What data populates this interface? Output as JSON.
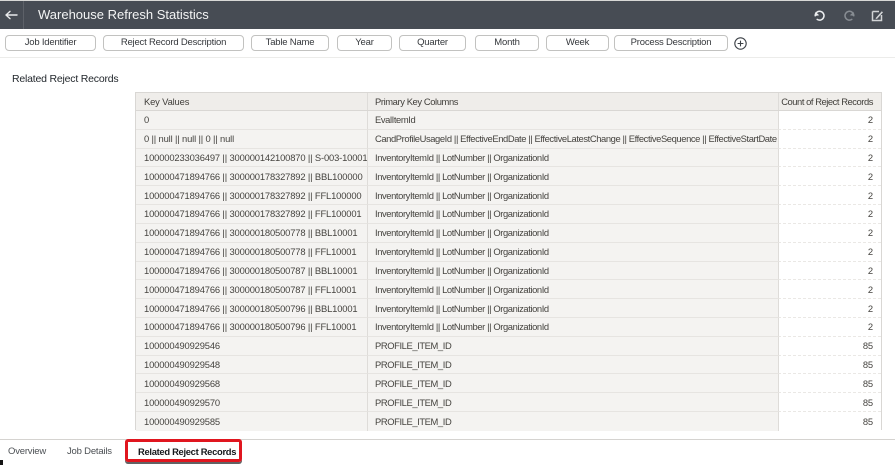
{
  "header": {
    "title": "Warehouse Refresh Statistics",
    "accent_color": "#474c54",
    "icons": [
      "back-arrow",
      "undo",
      "redo",
      "edit"
    ]
  },
  "filter_bar": {
    "chips": [
      {
        "label": "Job Identifier"
      },
      {
        "label": "Reject Record Description"
      },
      {
        "label": "Table Name"
      },
      {
        "label": "Year"
      },
      {
        "label": "Quarter"
      },
      {
        "label": "Month"
      },
      {
        "label": "Week"
      },
      {
        "label": "Process Description"
      }
    ],
    "add_filter_icon": "plus-circle"
  },
  "section": {
    "title": "Related Reject Records"
  },
  "table": {
    "columns": [
      "Key Values",
      "Primary Key Columns",
      "Count of Reject Records"
    ],
    "rows": [
      {
        "key_values": "0",
        "primary_key_columns": "EvalItemId",
        "count": "2"
      },
      {
        "key_values": "0 || null || null || 0 || null",
        "primary_key_columns": "CandProfileUsageId || EffectiveEndDate || EffectiveLatestChange || EffectiveSequence || EffectiveStartDate",
        "count": "2"
      },
      {
        "key_values": "100000233036497 || 300000142100870 || S-003-10001",
        "primary_key_columns": "InventoryItemId || LotNumber || OrganizationId",
        "count": "2"
      },
      {
        "key_values": "100000471894766 || 300000178327892 || BBL100000",
        "primary_key_columns": "InventoryItemId || LotNumber || OrganizationId",
        "count": "2"
      },
      {
        "key_values": "100000471894766 || 300000178327892 || FFL100000",
        "primary_key_columns": "InventoryItemId || LotNumber || OrganizationId",
        "count": "2"
      },
      {
        "key_values": "100000471894766 || 300000178327892 || FFL100001",
        "primary_key_columns": "InventoryItemId || LotNumber || OrganizationId",
        "count": "2"
      },
      {
        "key_values": "100000471894766 || 300000180500778 || BBL10001",
        "primary_key_columns": "InventoryItemId || LotNumber || OrganizationId",
        "count": "2"
      },
      {
        "key_values": "100000471894766 || 300000180500778 || FFL10001",
        "primary_key_columns": "InventoryItemId || LotNumber || OrganizationId",
        "count": "2"
      },
      {
        "key_values": "100000471894766 || 300000180500787 || BBL10001",
        "primary_key_columns": "InventoryItemId || LotNumber || OrganizationId",
        "count": "2"
      },
      {
        "key_values": "100000471894766 || 300000180500787 || FFL10001",
        "primary_key_columns": "InventoryItemId || LotNumber || OrganizationId",
        "count": "2"
      },
      {
        "key_values": "100000471894766 || 300000180500796 || BBL10001",
        "primary_key_columns": "InventoryItemId || LotNumber || OrganizationId",
        "count": "2"
      },
      {
        "key_values": "100000471894766 || 300000180500796 || FFL10001",
        "primary_key_columns": "InventoryItemId || LotNumber || OrganizationId",
        "count": "2"
      },
      {
        "key_values": "100000490929546",
        "primary_key_columns": "PROFILE_ITEM_ID",
        "count": "85"
      },
      {
        "key_values": "100000490929548",
        "primary_key_columns": "PROFILE_ITEM_ID",
        "count": "85"
      },
      {
        "key_values": "100000490929568",
        "primary_key_columns": "PROFILE_ITEM_ID",
        "count": "85"
      },
      {
        "key_values": "100000490929570",
        "primary_key_columns": "PROFILE_ITEM_ID",
        "count": "85"
      },
      {
        "key_values": "100000490929585",
        "primary_key_columns": "PROFILE_ITEM_ID",
        "count": "85"
      }
    ]
  },
  "footer_tabs": {
    "tabs": [
      {
        "label": "Overview",
        "active": false
      },
      {
        "label": "Job Details",
        "active": false
      },
      {
        "label": "Related Reject Records",
        "active": true
      }
    ],
    "annotation_color": "#e0161f"
  }
}
